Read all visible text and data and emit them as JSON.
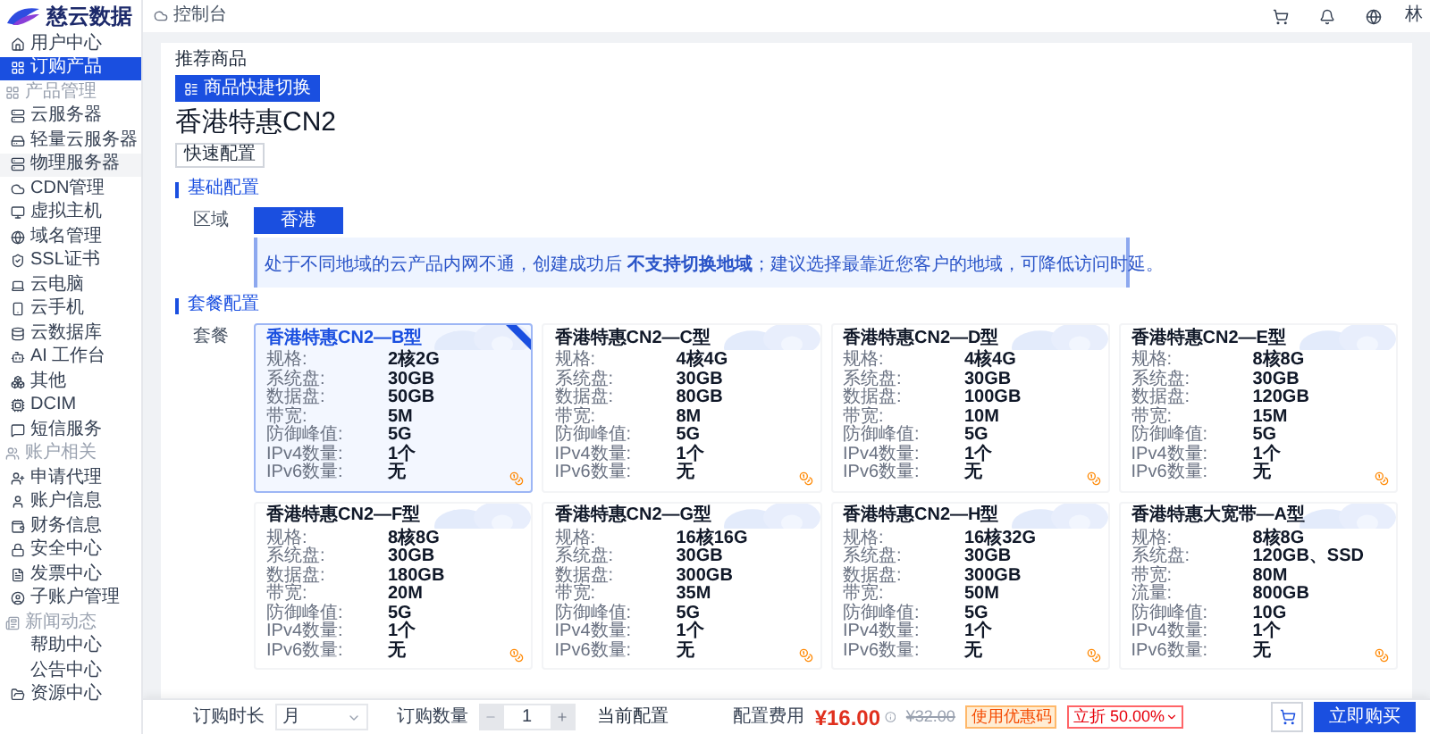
{
  "logo": {
    "text": "慈云数据"
  },
  "header": {
    "breadcrumb": "控制台",
    "user": "林"
  },
  "sidebar": {
    "items": [
      {
        "kind": "item",
        "label": "用户中心",
        "selected": false,
        "highlighted": false
      },
      {
        "kind": "item",
        "label": "订购产品",
        "selected": true,
        "highlighted": false
      },
      {
        "kind": "section",
        "label": "产品管理"
      },
      {
        "kind": "item",
        "label": "云服务器",
        "selected": false,
        "highlighted": false
      },
      {
        "kind": "item",
        "label": "轻量云服务器",
        "selected": false,
        "highlighted": false
      },
      {
        "kind": "item",
        "label": "物理服务器",
        "selected": false,
        "highlighted": true
      },
      {
        "kind": "item",
        "label": "CDN管理",
        "selected": false,
        "highlighted": false
      },
      {
        "kind": "item",
        "label": "虚拟主机",
        "selected": false,
        "highlighted": false
      },
      {
        "kind": "item",
        "label": "域名管理",
        "selected": false,
        "highlighted": false
      },
      {
        "kind": "item",
        "label": "SSL证书",
        "selected": false,
        "highlighted": false
      },
      {
        "kind": "item",
        "label": "云电脑",
        "selected": false,
        "highlighted": false
      },
      {
        "kind": "item",
        "label": "云手机",
        "selected": false,
        "highlighted": false
      },
      {
        "kind": "item",
        "label": "云数据库",
        "selected": false,
        "highlighted": false
      },
      {
        "kind": "item",
        "label": "AI 工作台",
        "selected": false,
        "highlighted": false
      },
      {
        "kind": "item",
        "label": "其他",
        "selected": false,
        "highlighted": false
      },
      {
        "kind": "item",
        "label": "DCIM",
        "selected": false,
        "highlighted": false
      },
      {
        "kind": "item",
        "label": "短信服务",
        "selected": false,
        "highlighted": false
      },
      {
        "kind": "section",
        "label": "账户相关"
      },
      {
        "kind": "item",
        "label": "申请代理",
        "selected": false,
        "highlighted": false
      },
      {
        "kind": "item",
        "label": "账户信息",
        "selected": false,
        "highlighted": false
      },
      {
        "kind": "item",
        "label": "财务信息",
        "selected": false,
        "highlighted": false
      },
      {
        "kind": "item",
        "label": "安全中心",
        "selected": false,
        "highlighted": false
      },
      {
        "kind": "item",
        "label": "发票中心",
        "selected": false,
        "highlighted": false
      },
      {
        "kind": "item",
        "label": "子账户管理",
        "selected": false,
        "highlighted": false
      },
      {
        "kind": "section",
        "label": "新闻动态"
      },
      {
        "kind": "item",
        "label": "帮助中心",
        "selected": false,
        "highlighted": false
      },
      {
        "kind": "item",
        "label": "公告中心",
        "selected": false,
        "highlighted": false
      },
      {
        "kind": "item",
        "label": "资源中心",
        "selected": false,
        "highlighted": false
      }
    ]
  },
  "page": {
    "section_label": "推荐商品",
    "switch_button": "商品快捷切换",
    "title": "香港特惠CN2",
    "quick_button": "快速配置"
  },
  "basic": {
    "heading": "基础配置",
    "region_label": "区域",
    "regions": [
      {
        "label": "香港",
        "selected": true
      }
    ],
    "notice": "处于不同地域的云产品内网不通，创建成功后 **不支持切换地域**；建议选择最靠近您客户的地域，可降低访问时延。"
  },
  "plans": {
    "heading": "套餐配置",
    "label": "套餐",
    "cards": [
      {
        "title": "香港特惠CN2—B型",
        "selected": true,
        "ribbon": true,
        "specs": [
          {
            "label": "规格:",
            "value": "2核2G"
          },
          {
            "label": "系统盘:",
            "value": "30GB"
          },
          {
            "label": "数据盘:",
            "value": "50GB"
          },
          {
            "label": "带宽:",
            "value": "5M"
          },
          {
            "label": "防御峰值:",
            "value": "5G"
          },
          {
            "label": "IPv4数量:",
            "value": "1个"
          },
          {
            "label": "IPv6数量:",
            "value": "无"
          }
        ]
      },
      {
        "title": "香港特惠CN2—C型",
        "selected": false,
        "ribbon": false,
        "specs": [
          {
            "label": "规格:",
            "value": "4核4G"
          },
          {
            "label": "系统盘:",
            "value": "30GB"
          },
          {
            "label": "数据盘:",
            "value": "80GB"
          },
          {
            "label": "带宽:",
            "value": "8M"
          },
          {
            "label": "防御峰值:",
            "value": "5G"
          },
          {
            "label": "IPv4数量:",
            "value": "1个"
          },
          {
            "label": "IPv6数量:",
            "value": "无"
          }
        ]
      },
      {
        "title": "香港特惠CN2—D型",
        "selected": false,
        "ribbon": false,
        "specs": [
          {
            "label": "规格:",
            "value": "4核4G"
          },
          {
            "label": "系统盘:",
            "value": "30GB"
          },
          {
            "label": "数据盘:",
            "value": "100GB"
          },
          {
            "label": "带宽:",
            "value": "10M"
          },
          {
            "label": "防御峰值:",
            "value": "5G"
          },
          {
            "label": "IPv4数量:",
            "value": "1个"
          },
          {
            "label": "IPv6数量:",
            "value": "无"
          }
        ]
      },
      {
        "title": "香港特惠CN2—E型",
        "selected": false,
        "ribbon": false,
        "specs": [
          {
            "label": "规格:",
            "value": "8核8G"
          },
          {
            "label": "系统盘:",
            "value": "30GB"
          },
          {
            "label": "数据盘:",
            "value": "120GB"
          },
          {
            "label": "带宽:",
            "value": "15M"
          },
          {
            "label": "防御峰值:",
            "value": "5G"
          },
          {
            "label": "IPv4数量:",
            "value": "1个"
          },
          {
            "label": "IPv6数量:",
            "value": "无"
          }
        ]
      },
      {
        "title": "香港特惠CN2—F型",
        "selected": false,
        "ribbon": false,
        "specs": [
          {
            "label": "规格:",
            "value": "8核8G"
          },
          {
            "label": "系统盘:",
            "value": "30GB"
          },
          {
            "label": "数据盘:",
            "value": "180GB"
          },
          {
            "label": "带宽:",
            "value": "20M"
          },
          {
            "label": "防御峰值:",
            "value": "5G"
          },
          {
            "label": "IPv4数量:",
            "value": "1个"
          },
          {
            "label": "IPv6数量:",
            "value": "无"
          }
        ]
      },
      {
        "title": "香港特惠CN2—G型",
        "selected": false,
        "ribbon": false,
        "specs": [
          {
            "label": "规格:",
            "value": "16核16G"
          },
          {
            "label": "系统盘:",
            "value": "30GB"
          },
          {
            "label": "数据盘:",
            "value": "300GB"
          },
          {
            "label": "带宽:",
            "value": "35M"
          },
          {
            "label": "防御峰值:",
            "value": "5G"
          },
          {
            "label": "IPv4数量:",
            "value": "1个"
          },
          {
            "label": "IPv6数量:",
            "value": "无"
          }
        ]
      },
      {
        "title": "香港特惠CN2—H型",
        "selected": false,
        "ribbon": false,
        "specs": [
          {
            "label": "规格:",
            "value": "16核32G"
          },
          {
            "label": "系统盘:",
            "value": "30GB"
          },
          {
            "label": "数据盘:",
            "value": "300GB"
          },
          {
            "label": "带宽:",
            "value": "50M"
          },
          {
            "label": "防御峰值:",
            "value": "5G"
          },
          {
            "label": "IPv4数量:",
            "value": "1个"
          },
          {
            "label": "IPv6数量:",
            "value": "无"
          }
        ]
      },
      {
        "title": "香港特惠大宽带—A型",
        "selected": false,
        "ribbon": false,
        "specs": [
          {
            "label": "规格:",
            "value": "8核8G"
          },
          {
            "label": "系统盘:",
            "value": "120GB、SSD"
          },
          {
            "label": "带宽:",
            "value": "80M"
          },
          {
            "label": "流量:",
            "value": "800GB"
          },
          {
            "label": "防御峰值:",
            "value": "10G"
          },
          {
            "label": "IPv4数量:",
            "value": "1个"
          },
          {
            "label": "IPv6数量:",
            "value": "无"
          }
        ]
      }
    ]
  },
  "order_bar": {
    "duration_label": "订购时长",
    "duration": "月",
    "quantity_label": "订购数量",
    "quantity": "1",
    "current_config": "当前配置",
    "fee_label": "配置费用",
    "price": "¥16.00",
    "original_price": "¥32.00",
    "coupon_tag": "使用优惠码",
    "discount_tag": "立折 50.00%",
    "buy_button": "立即购买"
  }
}
